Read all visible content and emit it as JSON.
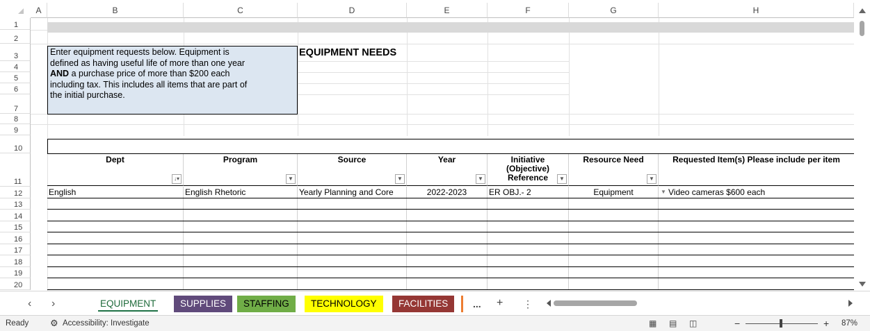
{
  "columns": [
    "A",
    "B",
    "C",
    "D",
    "E",
    "F",
    "G",
    "H"
  ],
  "rows": [
    "1",
    "2",
    "3",
    "4",
    "5",
    "6",
    "7",
    "8",
    "9",
    "10",
    "11",
    "12",
    "13",
    "14",
    "15",
    "16",
    "17",
    "18",
    "19",
    "20"
  ],
  "note": {
    "line1": "Enter equipment requests below.  Equipment is",
    "line2": "defined as having  useful life of more than one year",
    "line3_bold": "AND",
    "line3_rest": " a purchase price of more than $200 each",
    "line4": "including tax. This includes all items that are part of",
    "line5": "the initial purchase."
  },
  "title": "EQUIPMENT NEEDS",
  "table": {
    "headers": {
      "dept": "Dept",
      "program": "Program",
      "source": "Source",
      "year": "Year",
      "initiative": "Initiative (Objective) Reference",
      "resource": "Resource Need",
      "requested": "Requested Item(s) Please include per item"
    },
    "row1": {
      "dept": "English",
      "program": "English Rhetoric",
      "source": "Yearly Planning and Core",
      "year": "2022-2023",
      "initiative": "ER OBJ.- 2",
      "resource": "Equipment",
      "requested": "Video cameras $600 each"
    }
  },
  "tabs": {
    "equipment": "EQUIPMENT",
    "supplies": "SUPPLIES",
    "staffing": "STAFFING",
    "technology": "TECHNOLOGY",
    "facilities": "FACILITIES",
    "more": "...",
    "add": "+"
  },
  "status": {
    "ready": "Ready",
    "accessibility": "Accessibility: Investigate",
    "zoom": "87%"
  },
  "colors": {
    "note_bg": "#dce6f1",
    "supplies": "#604a7b",
    "staffing": "#70ad47",
    "technology": "#ffff00",
    "facilities": "#953734"
  }
}
